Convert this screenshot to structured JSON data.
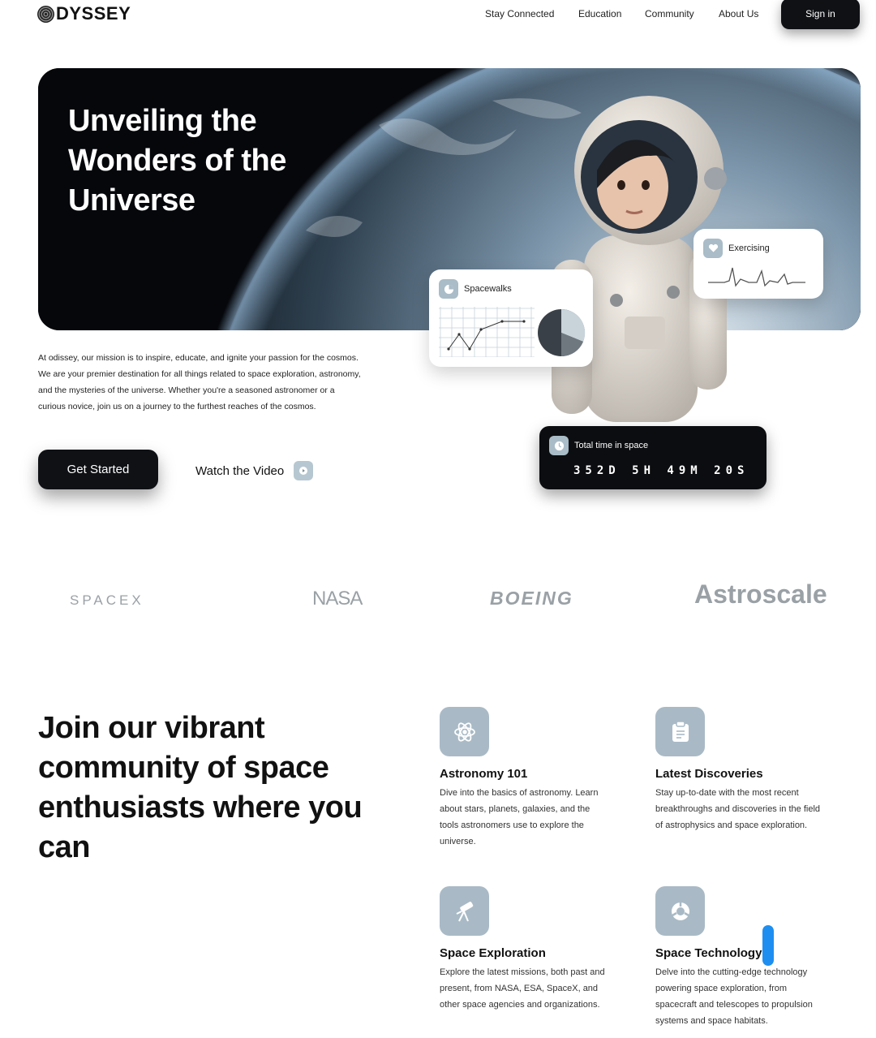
{
  "brand": {
    "name": "DYSSEY"
  },
  "nav": {
    "links": [
      "Stay Connected",
      "Education",
      "Community",
      "About Us"
    ],
    "signin_label": "Sign in"
  },
  "hero": {
    "title": "Unveiling the Wonders of the Universe",
    "intro": "At odissey, our mission is to inspire, educate, and ignite your passion for the cosmos. We are your premier destination for all things related to space exploration, astronomy, and the mysteries of the universe. Whether you're a seasoned astronomer or a curious novice, join us on a journey to the furthest reaches of the cosmos.",
    "get_started_label": "Get Started",
    "watch_label": "Watch the Video",
    "cards": {
      "spacewalks": {
        "label": "Spacewalks"
      },
      "exercising": {
        "label": "Exercising"
      },
      "time": {
        "label": "Total time in space",
        "value": "352D 5H 49M 20S"
      }
    }
  },
  "partners": [
    "SPACEX",
    "NASA",
    "BOEING",
    "Astroscale"
  ],
  "community": {
    "heading": "Join our vibrant community of space enthusiasts where you can",
    "features": [
      {
        "icon": "atom-icon",
        "title": "Astronomy 101",
        "desc": "Dive into the basics of astronomy. Learn about stars, planets, galaxies, and the tools astronomers use to explore the universe."
      },
      {
        "icon": "clipboard-icon",
        "title": "Latest Discoveries",
        "desc": "Stay up-to-date with the most recent breakthroughs and discoveries in the field of astrophysics and space exploration."
      },
      {
        "icon": "telescope-icon",
        "title": "Space Exploration",
        "desc": "Explore the latest missions, both past and present, from NASA, ESA, SpaceX, and other space agencies and organizations."
      },
      {
        "icon": "chip-icon",
        "title": "Space Technology",
        "desc": "Delve into the cutting-edge technology powering space exploration, from spacecraft and telescopes to propulsion systems and space habitats."
      }
    ]
  },
  "colors": {
    "dark": "#0f1115",
    "accent_icon": "#a9bac6",
    "partner_gray": "#9aa1a6"
  }
}
